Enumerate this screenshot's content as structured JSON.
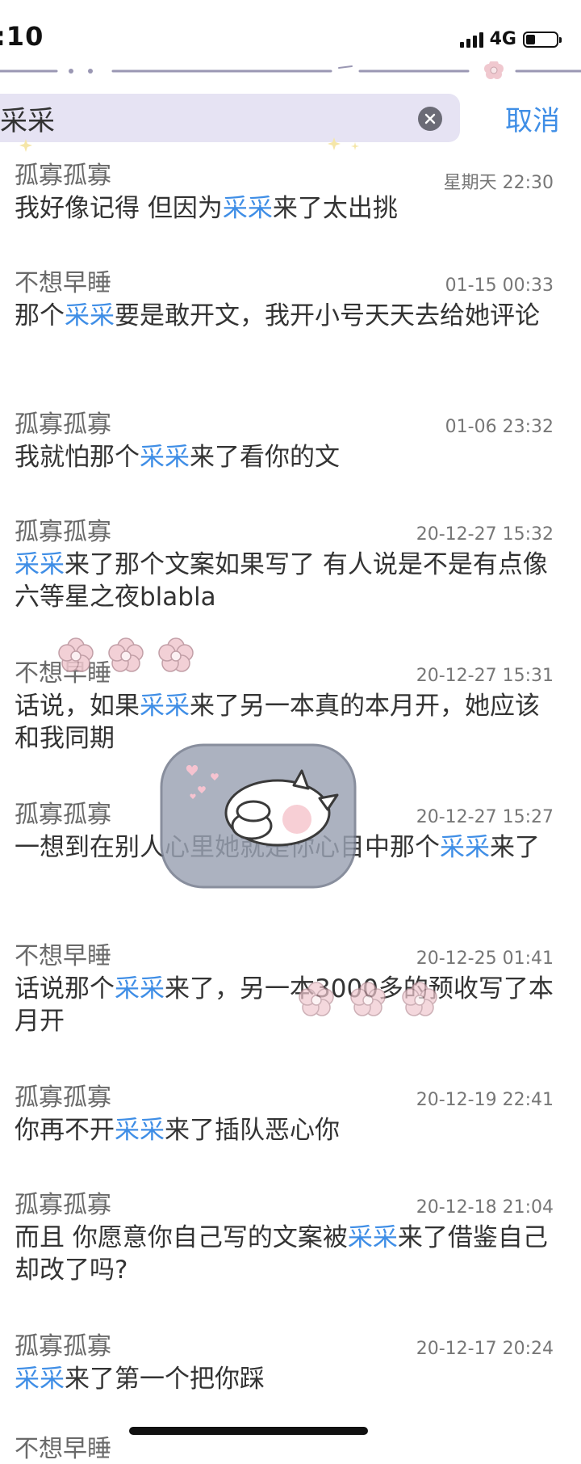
{
  "status_bar": {
    "time": ":10",
    "network": "4G",
    "battery_level": 0.3
  },
  "search": {
    "query": "采采",
    "cancel_label": "取消"
  },
  "highlight_term": "采采",
  "results": [
    {
      "name": "孤寡孤寡",
      "time": "星期天 22:30",
      "segments": [
        "我好像记得 但因为",
        "采采",
        "来了太出挑"
      ]
    },
    {
      "name": "不想早睡",
      "time": "01-15 00:33",
      "segments": [
        "那个",
        "采采",
        "要是敢开文，我开小号天天去给她评论"
      ]
    },
    {
      "name": "孤寡孤寡",
      "time": "01-06 23:32",
      "segments": [
        "我就怕那个",
        "采采",
        "来了看你的文"
      ]
    },
    {
      "name": "孤寡孤寡",
      "time": "20-12-27 15:32",
      "segments": [
        "",
        "采采",
        "来了那个文案如果写了 有人说是不是有点像六等星之夜blabla"
      ]
    },
    {
      "name": "不想早睡",
      "time": "20-12-27 15:31",
      "segments": [
        "话说，如果",
        "采采",
        "来了另一本真的本月开，她应该和我同期"
      ]
    },
    {
      "name": "孤寡孤寡",
      "time": "20-12-27 15:27",
      "segments": [
        "一想到在别人心里她就是你心目中那个",
        "采采",
        "来了"
      ]
    },
    {
      "name": "不想早睡",
      "time": "20-12-25 01:41",
      "segments": [
        "话说那个",
        "采采",
        "来了，另一本3000多的预收写了本月开"
      ]
    },
    {
      "name": "孤寡孤寡",
      "time": "20-12-19 22:41",
      "segments": [
        "你再不开",
        "采采",
        "来了插队恶心你"
      ]
    },
    {
      "name": "孤寡孤寡",
      "time": "20-12-18 21:04",
      "segments": [
        "而且 你愿意你自己写的文案被",
        "采采",
        "来了借鉴自己却改了吗?"
      ]
    },
    {
      "name": "孤寡孤寡",
      "time": "20-12-17 20:24",
      "segments": [
        "",
        "采采",
        "来了第一个把你踩"
      ]
    }
  ],
  "partial_result": {
    "name": "不想早睡"
  },
  "colors": {
    "highlight": "#3f8ee6",
    "search_bg": "#e6e3f3",
    "sticker_flower": "#f0c8cf",
    "sticker_cat_bg": "#9aa2b3"
  }
}
